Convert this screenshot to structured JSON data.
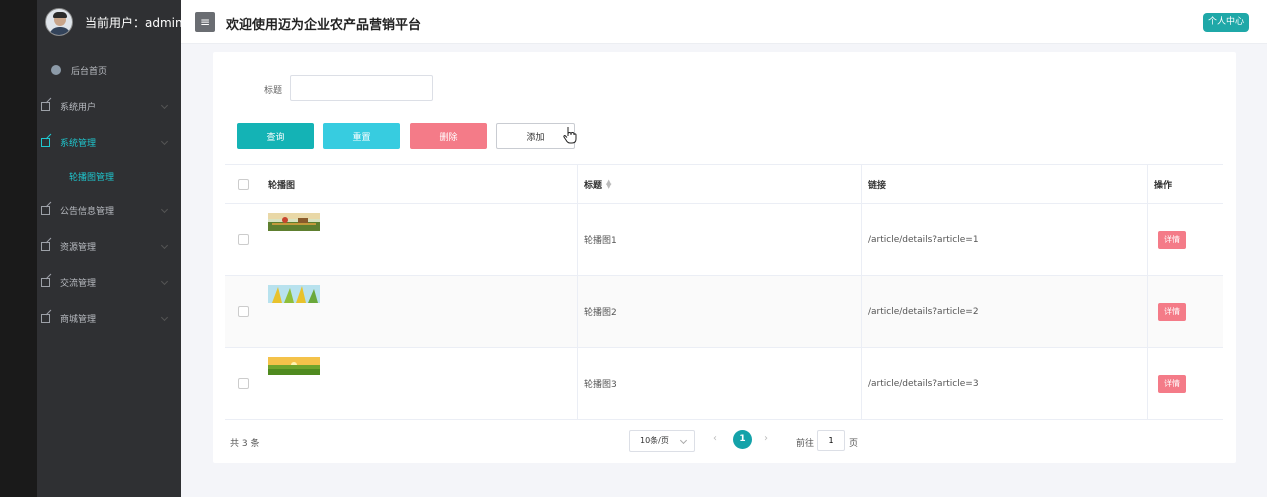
{
  "header": {
    "current_user": "当前用户：admin",
    "site_title": "欢迎使用迈为企业农产品营销平台",
    "profile_button": "个人中心"
  },
  "sidebar": {
    "home": "后台首页",
    "items": [
      {
        "label": "系统用户"
      },
      {
        "label": "系统管理"
      },
      {
        "label": "公告信息管理"
      },
      {
        "label": "资源管理"
      },
      {
        "label": "交流管理"
      },
      {
        "label": "商城管理"
      }
    ],
    "submenu": {
      "label": "轮播图管理"
    }
  },
  "search": {
    "label": "标题",
    "value": "",
    "placeholder": ""
  },
  "toolbar": {
    "query": "查询",
    "reset": "重置",
    "delete": "删除",
    "add": "添加"
  },
  "table": {
    "columns": {
      "image": "轮播图",
      "title": "标题",
      "link": "链接",
      "action": "操作"
    },
    "rows": [
      {
        "title": "轮播图1",
        "link": "/article/details?article=1",
        "action": "详情"
      },
      {
        "title": "轮播图2",
        "link": "/article/details?article=2",
        "action": "详情"
      },
      {
        "title": "轮播图3",
        "link": "/article/details?article=3",
        "action": "详情"
      }
    ]
  },
  "pagination": {
    "total": "共 3 条",
    "page_size": "10条/页",
    "current_page": "1",
    "goto_label": "前往",
    "goto_value": "1",
    "goto_suffix": "页"
  },
  "colors": {
    "accent": "#14b3b5",
    "reset": "#37cce0",
    "danger": "#f47b88",
    "sidebar_bg": "#2f3033"
  }
}
